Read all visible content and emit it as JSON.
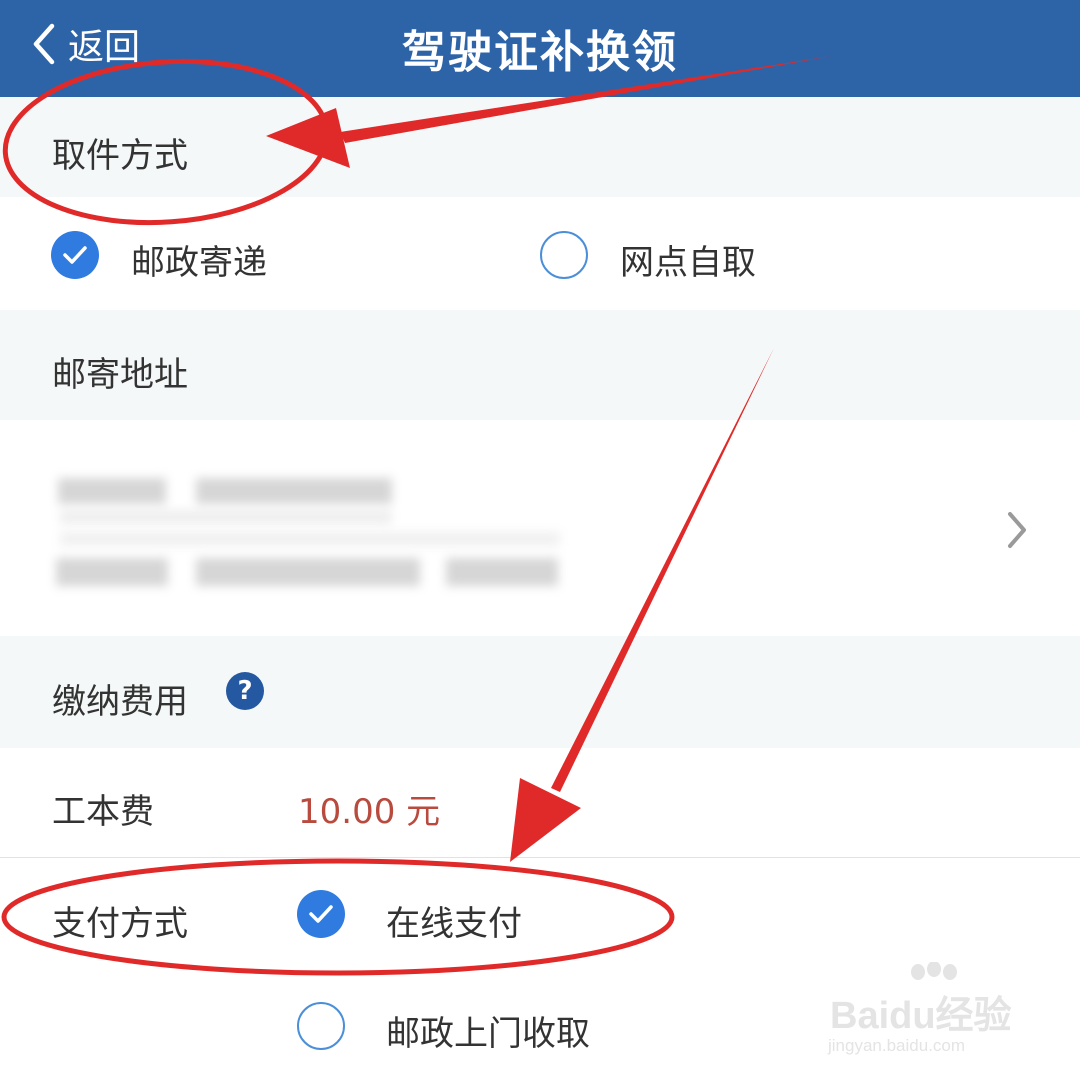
{
  "header": {
    "back_label": "返回",
    "title": "驾驶证补换领",
    "bg_color": "#2d64a8"
  },
  "pickup": {
    "section_title": "取件方式",
    "options": [
      {
        "label": "邮政寄递",
        "checked": true
      },
      {
        "label": "网点自取",
        "checked": false
      }
    ]
  },
  "address": {
    "section_title": "邮寄地址",
    "value_redacted": true,
    "chevron_icon": "chevron-right-icon"
  },
  "fee": {
    "section_title": "缴纳费用",
    "help_icon": "question-circle-icon",
    "help_glyph": "?",
    "item_label": "工本费",
    "item_value": "10.00 元",
    "value_color": "#b84a3e"
  },
  "payment": {
    "label": "支付方式",
    "options": [
      {
        "label": "在线支付",
        "checked": true
      },
      {
        "label": "邮政上门收取",
        "checked": false
      }
    ]
  },
  "watermark": {
    "brand": "Baidu经验",
    "url": "jingyan.baidu.com"
  },
  "annotation_color": "#e02a2a"
}
